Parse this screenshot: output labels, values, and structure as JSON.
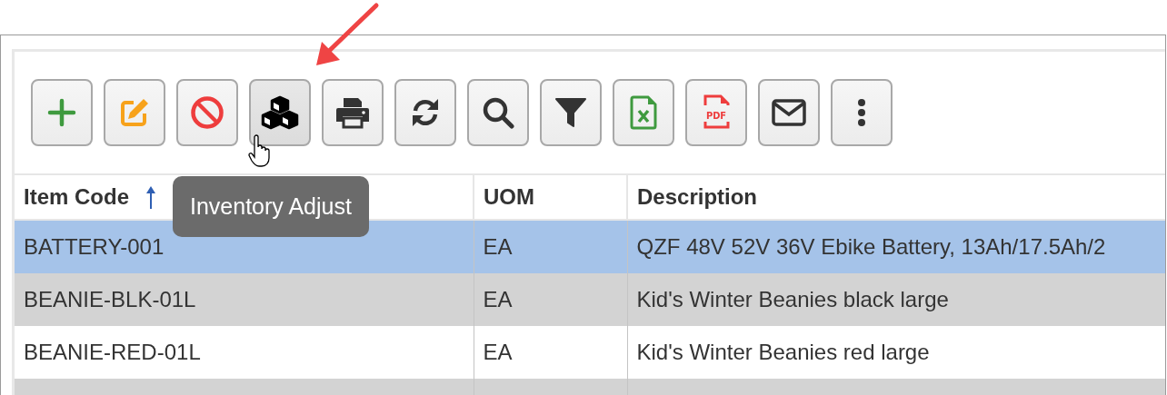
{
  "toolbar": {
    "buttons": [
      {
        "kind": "add",
        "hovered": false
      },
      {
        "kind": "edit",
        "hovered": false
      },
      {
        "kind": "cancel",
        "hovered": false
      },
      {
        "kind": "inventory",
        "hovered": true
      },
      {
        "kind": "print",
        "hovered": false
      },
      {
        "kind": "refresh",
        "hovered": false
      },
      {
        "kind": "search",
        "hovered": false
      },
      {
        "kind": "filter",
        "hovered": false
      },
      {
        "kind": "excel",
        "hovered": false
      },
      {
        "kind": "pdf",
        "hovered": false,
        "icon_text": "PDF"
      },
      {
        "kind": "email",
        "hovered": false
      },
      {
        "kind": "more",
        "hovered": false
      }
    ]
  },
  "tooltip": {
    "text": "Inventory Adjust"
  },
  "table": {
    "columns": [
      {
        "label": "Item Code",
        "sorted": true
      },
      {
        "label": "UOM",
        "sorted": false
      },
      {
        "label": "Description",
        "sorted": false
      }
    ],
    "rows": [
      {
        "selected": true,
        "cells": [
          "BATTERY-001",
          "EA",
          "QZF 48V 52V 36V Ebike Battery, 13Ah/17.5Ah/2"
        ]
      },
      {
        "selected": false,
        "cells": [
          "BEANIE-BLK-01L",
          "EA",
          "Kid's Winter Beanies black large"
        ]
      },
      {
        "selected": false,
        "cells": [
          "BEANIE-RED-01L",
          "EA",
          "Kid's Winter Beanies red large"
        ]
      }
    ]
  }
}
